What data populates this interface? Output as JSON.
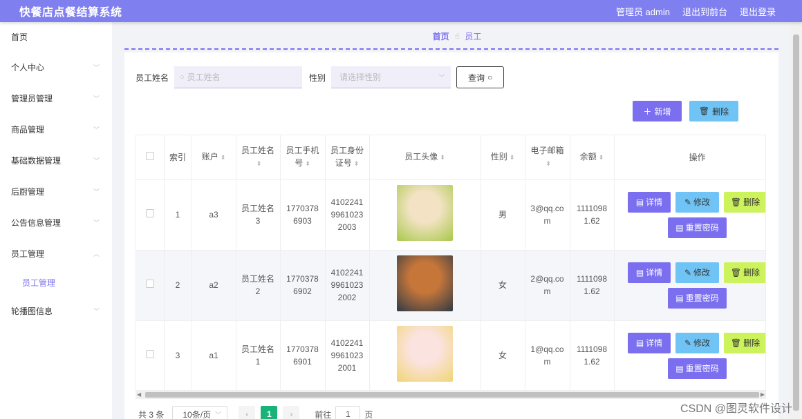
{
  "header": {
    "title": "快餐店点餐结算系统",
    "admin": "管理员 admin",
    "exit_front": "退出到前台",
    "logout": "退出登录"
  },
  "sidebar": {
    "items": [
      {
        "label": "首页"
      },
      {
        "label": "个人中心"
      },
      {
        "label": "管理员管理"
      },
      {
        "label": "商品管理"
      },
      {
        "label": "基础数据管理"
      },
      {
        "label": "后厨管理"
      },
      {
        "label": "公告信息管理"
      },
      {
        "label": "员工管理"
      }
    ],
    "sub_item": "员工管理",
    "last_item": "轮播图信息"
  },
  "breadcrumb": {
    "home": "首页",
    "current": "员工"
  },
  "search": {
    "name_label": "员工姓名",
    "name_placeholder": "员工姓名",
    "gender_label": "性别",
    "gender_placeholder": "请选择性别",
    "query_label": "查询"
  },
  "actions": {
    "add_label": "新增",
    "delete_label": "删除"
  },
  "table": {
    "headers": [
      "索引",
      "账户",
      "员工姓名",
      "员工手机号",
      "员工身份证号",
      "员工头像",
      "性别",
      "电子邮箱",
      "余额",
      "操作"
    ],
    "rows": [
      {
        "index": "1",
        "account": "a3",
        "name": "员工姓名3",
        "phone": "17703786903",
        "id_card": "410224199610232003",
        "gender": "男",
        "email": "3@qq.com",
        "balance": "11110981.62",
        "avatar_colors": [
          "#f3e3c4",
          "#a8c84a"
        ]
      },
      {
        "index": "2",
        "account": "a2",
        "name": "员工姓名2",
        "phone": "17703786902",
        "id_card": "410224199610232002",
        "gender": "女",
        "email": "2@qq.com",
        "balance": "11110981.62",
        "avatar_colors": [
          "#c7763a",
          "#2f3a45"
        ]
      },
      {
        "index": "3",
        "account": "a1",
        "name": "员工姓名1",
        "phone": "17703786901",
        "id_card": "410224199610232001",
        "gender": "女",
        "email": "1@qq.com",
        "balance": "11110981.62",
        "avatar_colors": [
          "#fbe3e0",
          "#f1d573"
        ]
      }
    ],
    "ops": {
      "view": "详情",
      "edit": "修改",
      "del": "删除",
      "reset": "重置密码"
    }
  },
  "pager": {
    "total": "共 3 条",
    "page_size": "10条/页",
    "current_page": "1",
    "goto_label": "前往",
    "goto_value": "1",
    "page_suffix": "页"
  },
  "watermark": "CSDN @图灵软件设计",
  "colors": {
    "header": "#7f7ff0",
    "accent": "#7b6ff0",
    "edit": "#6fc4f5",
    "del": "#cdf35c",
    "pager_active": "#19b37a"
  }
}
